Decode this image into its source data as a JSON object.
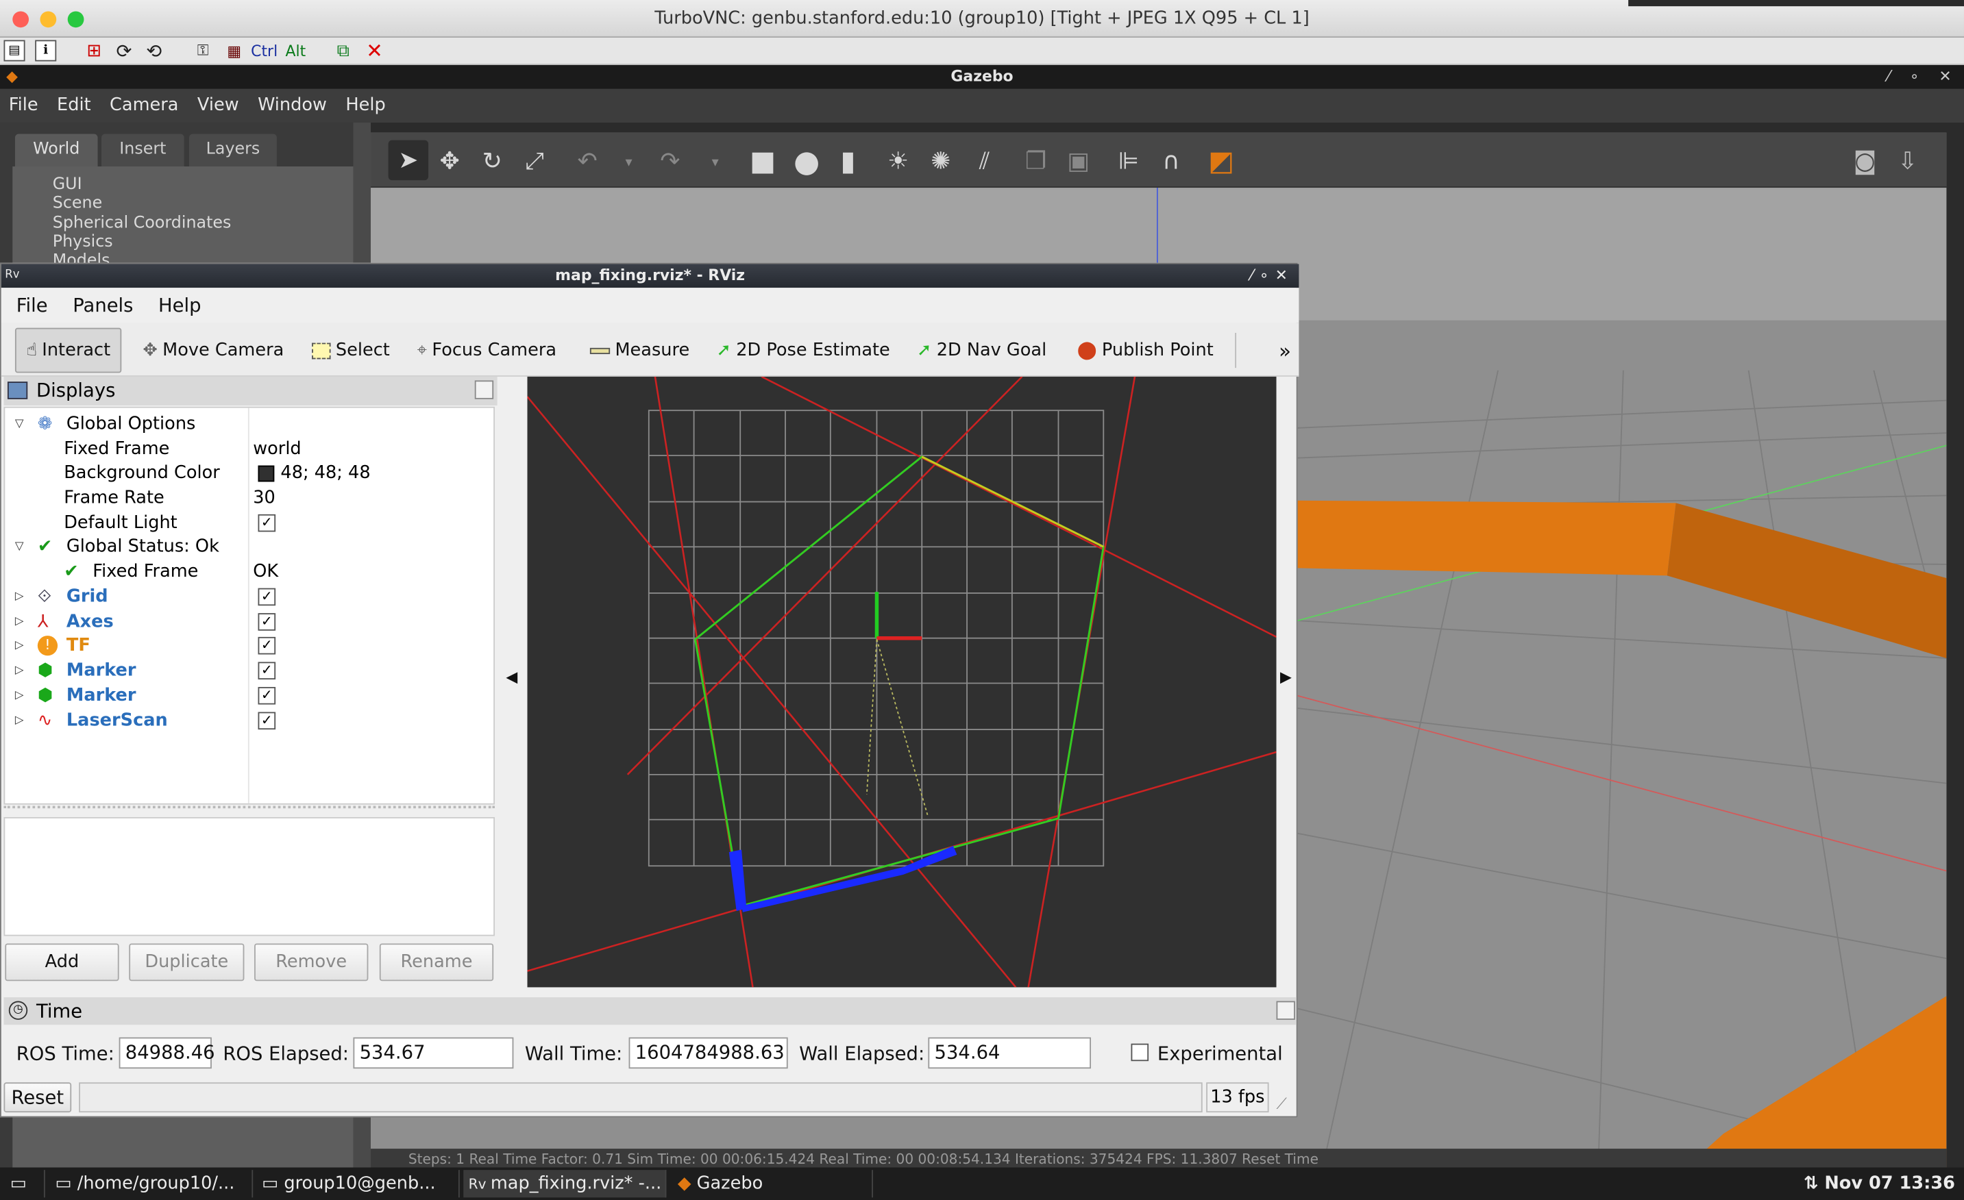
{
  "mac": {
    "title": "TurboVNC: genbu.stanford.edu:10 (group10) [Tight + JPEG 1X Q95 + CL 1]"
  },
  "vnc_toolbar": {
    "ctrl_label": "Ctrl",
    "alt_label": "Alt"
  },
  "gazebo": {
    "window_title": "Gazebo",
    "menu": [
      "File",
      "Edit",
      "Camera",
      "View",
      "Window",
      "Help"
    ],
    "tabs": [
      "World",
      "Insert",
      "Layers"
    ],
    "tree": [
      "GUI",
      "Scene",
      "Spherical Coordinates",
      "Physics",
      "Models"
    ],
    "bottom_status": "Steps: 1     Real Time Factor: 0.71     Sim Time: 00 00:06:15.424     Real Time: 00 00:08:54.134     Iterations: 375424     FPS: 11.3807     Reset Time"
  },
  "rviz": {
    "window_title": "map_fixing.rviz* - RViz",
    "menu": [
      "File",
      "Panels",
      "Help"
    ],
    "tools": [
      "Interact",
      "Move Camera",
      "Select",
      "Focus Camera",
      "Measure",
      "2D Pose Estimate",
      "2D Nav Goal",
      "Publish Point"
    ],
    "more_label": "»",
    "displays_title": "Displays",
    "tree": {
      "global_options": "Global Options",
      "fixed_frame_label": "Fixed Frame",
      "fixed_frame_value": "world",
      "bg_color_label": "Background Color",
      "bg_color_value": "48; 48; 48",
      "frame_rate_label": "Frame Rate",
      "frame_rate_value": "30",
      "default_light_label": "Default Light",
      "global_status_label": "Global Status: Ok",
      "fixed_frame_status_label": "Fixed Frame",
      "fixed_frame_status_value": "OK",
      "items": [
        "Grid",
        "Axes",
        "TF",
        "Marker",
        "Marker",
        "LaserScan"
      ]
    },
    "buttons": {
      "add": "Add",
      "duplicate": "Duplicate",
      "remove": "Remove",
      "rename": "Rename"
    },
    "time": {
      "title": "Time",
      "ros_time_label": "ROS Time:",
      "ros_time_value": "84988.46",
      "ros_elapsed_label": "ROS Elapsed:",
      "ros_elapsed_value": "534.67",
      "wall_time_label": "Wall Time:",
      "wall_time_value": "1604784988.63",
      "wall_elapsed_label": "Wall Elapsed:",
      "wall_elapsed_value": "534.64",
      "experimental_label": "Experimental"
    },
    "reset_label": "Reset",
    "fps": "13 fps"
  },
  "taskbar": {
    "items": [
      "/home/group10/...",
      "group10@genb...",
      "map_fixing.rviz* -...",
      "Gazebo"
    ],
    "clock": "Nov 07 13:36"
  },
  "colors": {
    "accent_blue": "#2a6ebb",
    "rviz_bg": "#303030",
    "gazebo_orange": "#e07812"
  }
}
